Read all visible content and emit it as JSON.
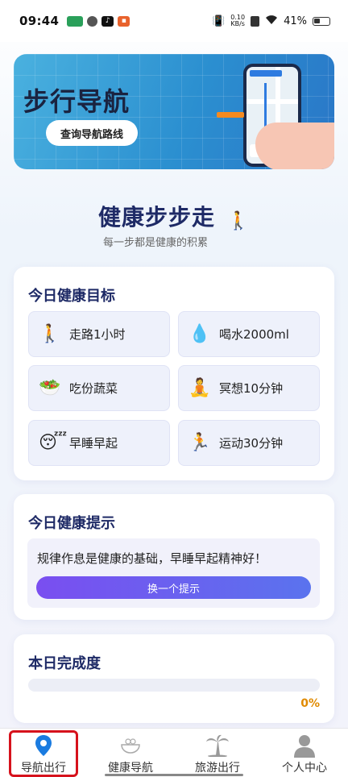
{
  "status_bar": {
    "time": "09:44",
    "speed_value": "0.10",
    "speed_unit": "KB/s",
    "battery": "41%"
  },
  "banner": {
    "title": "步行导航",
    "button_label": "查询导航路线"
  },
  "hero": {
    "title": "健康步步走",
    "subtitle": "每一步都是健康的积累"
  },
  "goals_card": {
    "title": "今日健康目标",
    "items": [
      {
        "icon": "walking-person-icon",
        "label": "走路1小时"
      },
      {
        "icon": "water-drop-icon",
        "label": "喝水2000ml"
      },
      {
        "icon": "salad-icon",
        "label": "吃份蔬菜"
      },
      {
        "icon": "meditation-icon",
        "label": "冥想10分钟"
      },
      {
        "icon": "sleeping-face-icon",
        "label": "早睡早起"
      },
      {
        "icon": "running-person-icon",
        "label": "运动30分钟"
      }
    ]
  },
  "tips_card": {
    "title": "今日健康提示",
    "tip_text": "规律作息是健康的基础，早睡早起精神好！",
    "button_label": "换一个提示"
  },
  "progress_card": {
    "title": "本日完成度",
    "percent_text": "0%",
    "percent_value": 0
  },
  "bottom_nav": {
    "items": [
      {
        "label": "导航出行",
        "active": true
      },
      {
        "label": "健康导航",
        "active": false
      },
      {
        "label": "旅游出行",
        "active": false
      },
      {
        "label": "个人中心",
        "active": false
      }
    ]
  },
  "colors": {
    "accent": "#5a73ee",
    "title_navy": "#1e2a66",
    "progress": "#e08a00",
    "active_nav": "#1a7be0",
    "highlight_frame": "#d6121c"
  }
}
